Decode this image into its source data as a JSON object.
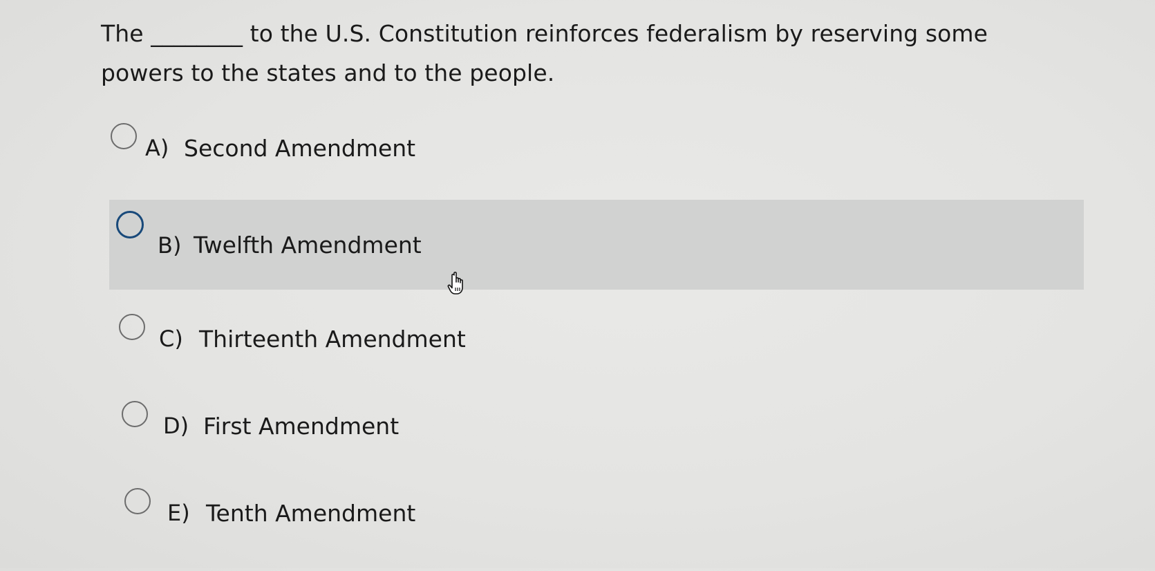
{
  "question": {
    "text": "The ________ to the U.S. Constitution reinforces federalism by reserving some powers to the states and to the people."
  },
  "options": [
    {
      "letter": "A)",
      "label": "Second Amendment"
    },
    {
      "letter": "B)",
      "label": "Twelfth Amendment"
    },
    {
      "letter": "C)",
      "label": "Thirteenth Amendment"
    },
    {
      "letter": "D)",
      "label": "First Amendment"
    },
    {
      "letter": "E)",
      "label": "Tenth Amendment"
    }
  ],
  "state": {
    "hovered_option": "B)",
    "selected_option": null
  },
  "colors": {
    "background": "#e6e6e4",
    "hover_row": "#d1d2d1",
    "radio_focus": "#18497a",
    "text": "#1a1a1a"
  },
  "icons": {
    "cursor": "hand-pointer-icon",
    "radio": "radio-button-icon"
  }
}
